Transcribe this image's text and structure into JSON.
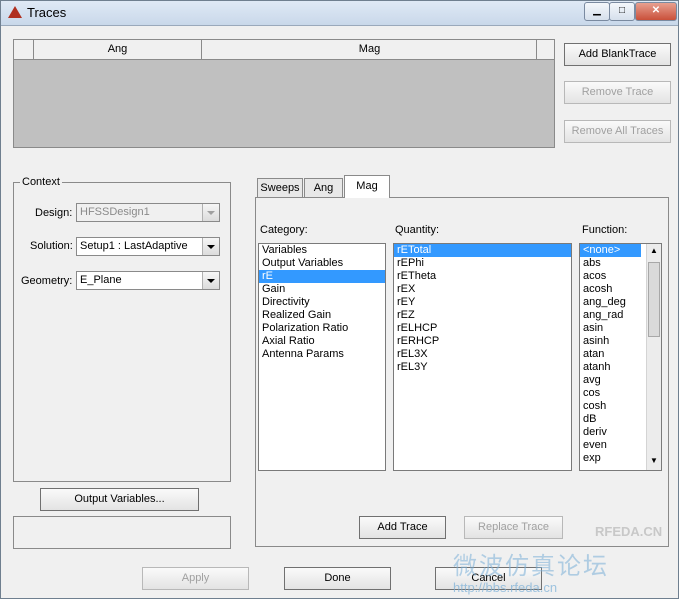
{
  "window": {
    "title": "Traces"
  },
  "traces_table": {
    "columns": [
      "Ang",
      "Mag"
    ]
  },
  "buttons": {
    "add_blank_trace": "Add BlankTrace",
    "remove_trace": "Remove Trace",
    "remove_all_traces": "Remove All Traces",
    "output_variables": "Output Variables...",
    "add_trace": "Add Trace",
    "replace_trace": "Replace Trace",
    "apply": "Apply",
    "done": "Done",
    "cancel": "Cancel"
  },
  "context": {
    "title": "Context",
    "design_label": "Design:",
    "design_value": "HFSSDesign1",
    "solution_label": "Solution:",
    "solution_value": "Setup1 : LastAdaptive",
    "geometry_label": "Geometry:",
    "geometry_value": "E_Plane"
  },
  "tabs": [
    "Sweeps",
    "Ang",
    "Mag"
  ],
  "active_tab": "Mag",
  "category": {
    "label": "Category:",
    "items": [
      "Variables",
      "Output Variables",
      "rE",
      "Gain",
      "Directivity",
      "Realized Gain",
      "Polarization Ratio",
      "Axial Ratio",
      "Antenna Params"
    ],
    "selected": "rE"
  },
  "quantity": {
    "label": "Quantity:",
    "items": [
      "rETotal",
      "rEPhi",
      "rETheta",
      "rEX",
      "rEY",
      "rEZ",
      "rELHCP",
      "rERHCP",
      "rEL3X",
      "rEL3Y"
    ],
    "selected": "rETotal"
  },
  "function": {
    "label": "Function:",
    "items": [
      "<none>",
      "abs",
      "acos",
      "acosh",
      "ang_deg",
      "ang_rad",
      "asin",
      "asinh",
      "atan",
      "atanh",
      "avg",
      "cos",
      "cosh",
      "dB",
      "deriv",
      "even",
      "exp"
    ],
    "selected": "<none>"
  },
  "watermark": {
    "logo": "RFEDA.CN",
    "cn": "微波仿真论坛",
    "url": "http://bbs.rfeda.cn"
  }
}
